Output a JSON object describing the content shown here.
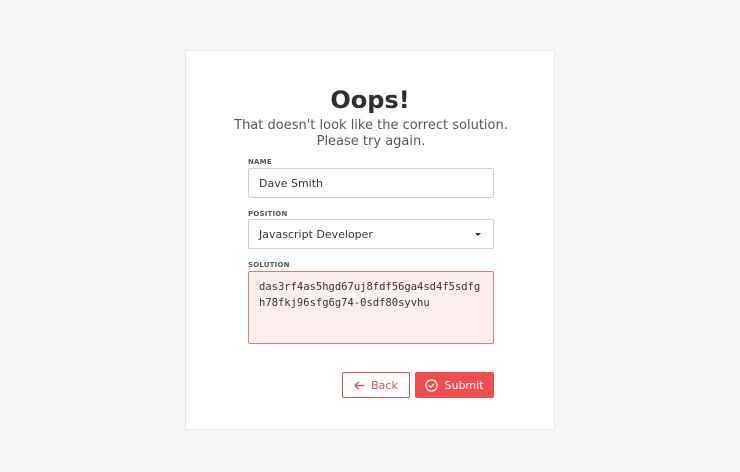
{
  "header": {
    "title": "Oops!",
    "subtitle": "That doesn't look like the correct solution. Please try again."
  },
  "form": {
    "name": {
      "label": "NAME",
      "value": "Dave Smith"
    },
    "position": {
      "label": "POSITION",
      "selected": "Javascript Developer"
    },
    "solution": {
      "label": "SOLUTION",
      "value": "das3rf4as5hgd67uj8fdf56ga4sd4f5sdfgh78fkj96sfg6g74-0sdf80syvhu"
    }
  },
  "actions": {
    "back_label": "Back",
    "submit_label": "Submit"
  },
  "colors": {
    "accent": "#ee4e4e",
    "error_bg": "#ffeeee",
    "error_border": "#e07a7a"
  }
}
